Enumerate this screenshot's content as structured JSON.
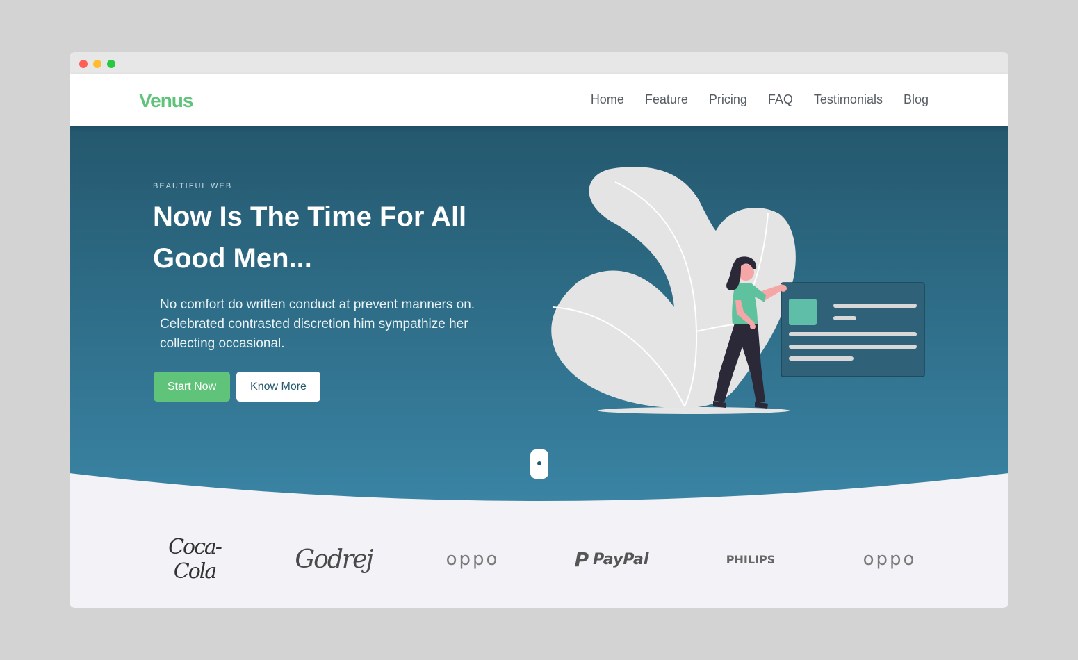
{
  "window": {
    "controls": [
      "close",
      "minimize",
      "maximize"
    ]
  },
  "navbar": {
    "logo": "Venus",
    "links": [
      "Home",
      "Feature",
      "Pricing",
      "FAQ",
      "Testimonials",
      "Blog"
    ]
  },
  "hero": {
    "eyebrow": "BEAUTIFUL WEB",
    "title": "Now Is The Time For All Good Men...",
    "description": "No comfort do written conduct at prevent manners on. Celebrated contrasted discretion him sympathize her collecting occasional.",
    "primary_button": "Start Now",
    "secondary_button": "Know More",
    "illustration": "woman-with-dashboard-card-illustration"
  },
  "brands": [
    "Coca-Cola",
    "Godrej",
    "oppo",
    "PayPal",
    "PHILIPS",
    "oppo"
  ],
  "colors": {
    "accent": "#5fc37a",
    "hero_top": "#24586e",
    "hero_bottom": "#3a84a4",
    "page_bg": "#f2f2f7"
  }
}
